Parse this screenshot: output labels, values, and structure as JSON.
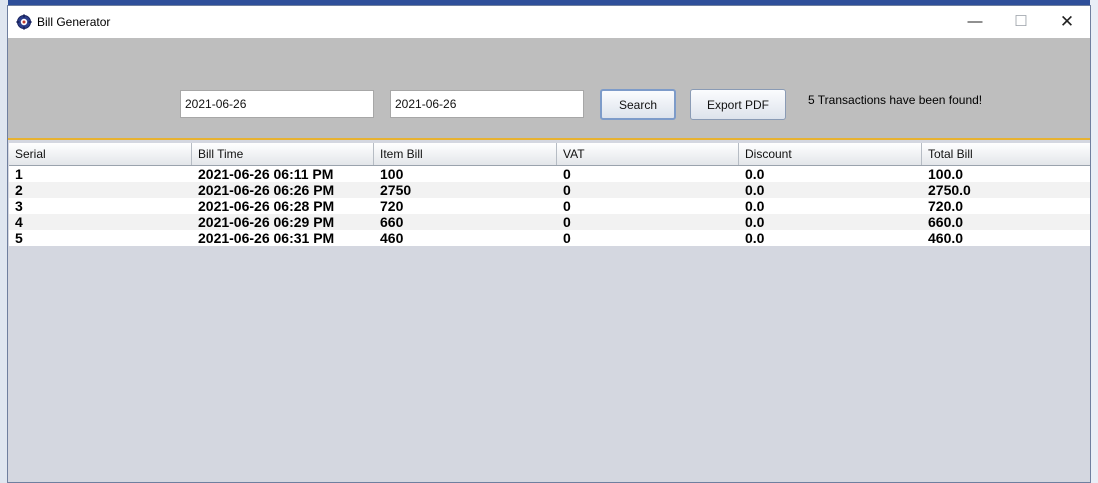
{
  "window": {
    "title": "Bill Generator",
    "icon": "gear-app-icon",
    "minimize_glyph": "—",
    "maximize_glyph": "☐",
    "close_glyph": "✕"
  },
  "search": {
    "from_date": "2021-06-26",
    "to_date": "2021-06-26",
    "search_label": "Search",
    "export_label": "Export PDF",
    "status_text": "5 Transactions have been found!"
  },
  "table": {
    "columns": [
      "Serial",
      "Bill Time",
      "Item Bill",
      "VAT",
      "Discount",
      "Total Bill"
    ],
    "rows": [
      [
        "1",
        "2021-06-26 06:11 PM",
        "100",
        "0",
        "0.0",
        "100.0"
      ],
      [
        "2",
        "2021-06-26 06:26 PM",
        "2750",
        "0",
        "0.0",
        "2750.0"
      ],
      [
        "3",
        "2021-06-26 06:28 PM",
        "720",
        "0",
        "0.0",
        "720.0"
      ],
      [
        "4",
        "2021-06-26 06:29 PM",
        "660",
        "0",
        "0.0",
        "660.0"
      ],
      [
        "5",
        "2021-06-26 06:31 PM",
        "460",
        "0",
        "0.0",
        "460.0"
      ]
    ]
  },
  "colors": {
    "header_bar": "#bebebe",
    "table_bg": "#d4d7e0",
    "selection_accent": "#e8b230"
  }
}
